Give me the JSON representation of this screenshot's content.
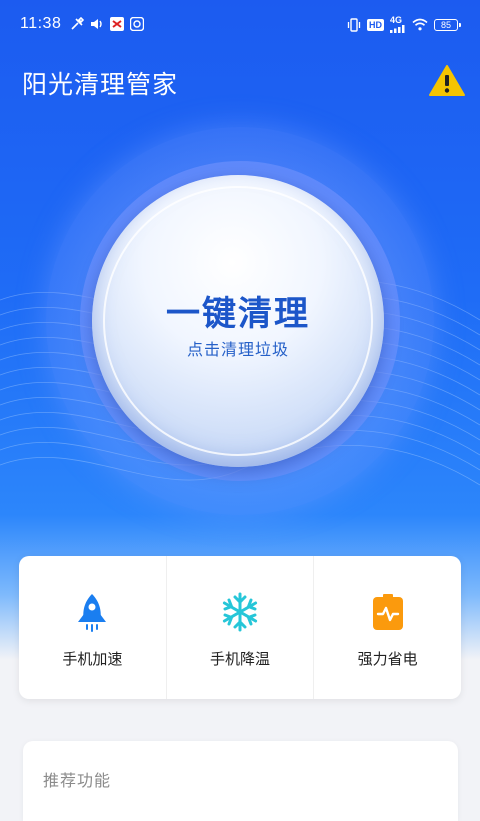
{
  "status_bar": {
    "time": "11:38",
    "hd_badge": "HD",
    "network": "4G",
    "battery": "85"
  },
  "header": {
    "title": "阳光清理管家"
  },
  "clean": {
    "title": "一键清理",
    "subtitle": "点击清理垃圾"
  },
  "features": [
    {
      "label": "手机加速",
      "icon": "rocket-icon",
      "color": "#1a7ef0"
    },
    {
      "label": "手机降温",
      "icon": "snowflake-icon",
      "color": "#26c6d8"
    },
    {
      "label": "强力省电",
      "icon": "battery-pulse-icon",
      "color": "#fb9a0d"
    }
  ],
  "recommend": {
    "title": "推荐功能"
  },
  "colors": {
    "primary": "#1c5bf0",
    "accent_text": "#1c56c9",
    "warning": "#f5c400"
  }
}
